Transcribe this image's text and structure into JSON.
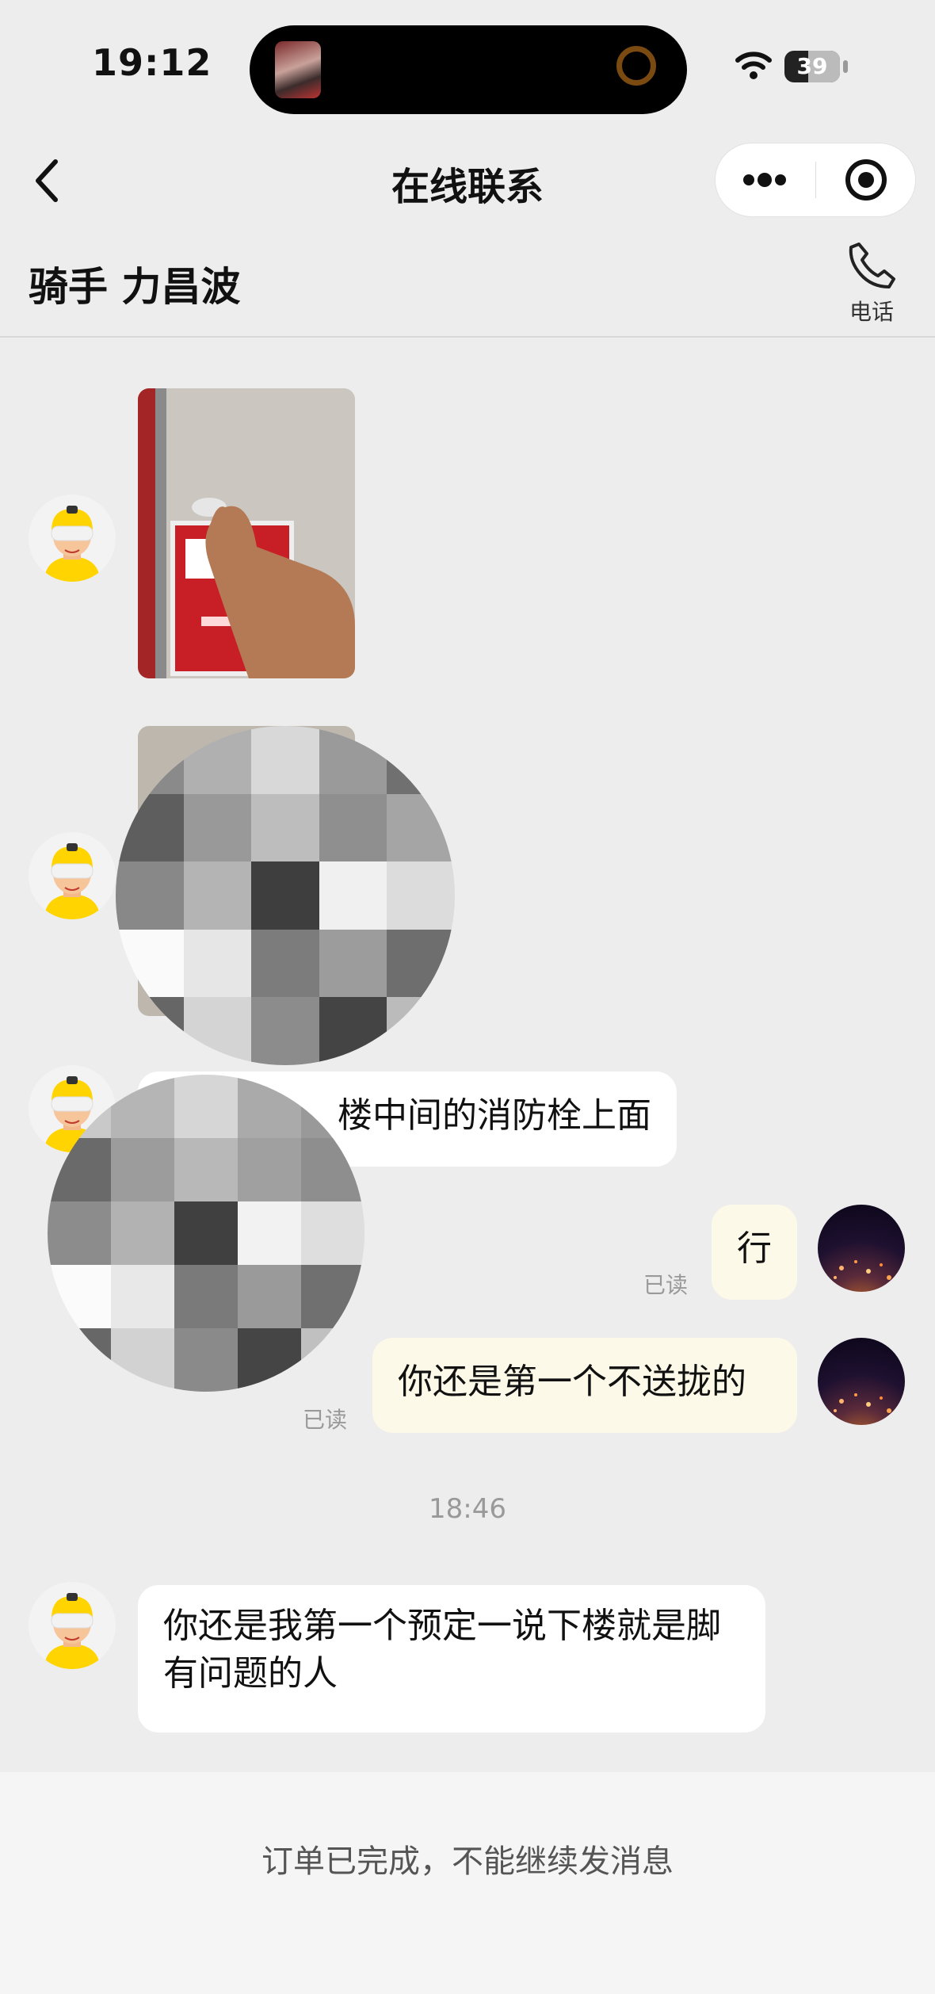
{
  "status_bar": {
    "time": "19:12",
    "battery": "39"
  },
  "nav": {
    "title": "在线联系"
  },
  "rider": {
    "name": "骑手 力昌波",
    "phone_label": "电话"
  },
  "messages": {
    "m3_text": "楼中间的消防栓上面",
    "m4_text": "行",
    "m4_status": "已读",
    "m5_text": "你还是第一个不送拢的",
    "m5_status": "已读",
    "time_separator": "18:46",
    "m6_text": "你还是我第一个预定一说下楼就是脚有问题的人"
  },
  "footer": {
    "text": "订单已完成，不能继续发消息"
  },
  "icons": [
    "back-icon",
    "more-icon",
    "mini-program-close-icon",
    "phone-icon",
    "rider-avatar",
    "user-avatar",
    "wifi-icon",
    "battery-icon"
  ],
  "colors": {
    "page_bg": "#ededed",
    "self_bubble": "#fdf9e8",
    "other_bubble": "#ffffff",
    "rider_helmet": "#ffd400"
  }
}
